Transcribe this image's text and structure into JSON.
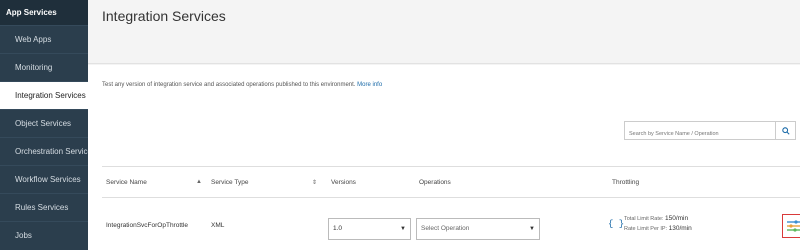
{
  "sidebar": {
    "heading": "App Services",
    "items": [
      {
        "label": "Web Apps"
      },
      {
        "label": "Monitoring"
      },
      {
        "label": "Integration Services"
      },
      {
        "label": "Object Services"
      },
      {
        "label": "Orchestration Services"
      },
      {
        "label": "Workflow Services"
      },
      {
        "label": "Rules Services"
      },
      {
        "label": "Jobs"
      }
    ],
    "active_index": 2
  },
  "page": {
    "title": "Integration Services",
    "description": "Test any version of integration service and associated operations published to this environment.",
    "more_info": "More info"
  },
  "search": {
    "placeholder": "Search by Service Name / Operation",
    "icon": "search-icon"
  },
  "table": {
    "headers": {
      "service_name": "Service Name",
      "service_type": "Service Type",
      "versions": "Versions",
      "operations": "Operations",
      "throttling": "Throttling"
    },
    "rows": [
      {
        "service_name": "IntegrationSvcForOpThrottle",
        "service_type": "XML",
        "version": "1.0",
        "operation": "Select Operation",
        "total_limit_label": "Total Limit Rate:",
        "total_limit_value": "150/min",
        "per_ip_label": "Rate Limit Per IP:",
        "per_ip_value": "130/min"
      }
    ]
  },
  "colors": {
    "sidebar_bg": "#2b3e4d",
    "link": "#1a6aa8",
    "highlight_border": "#d93a3a"
  }
}
